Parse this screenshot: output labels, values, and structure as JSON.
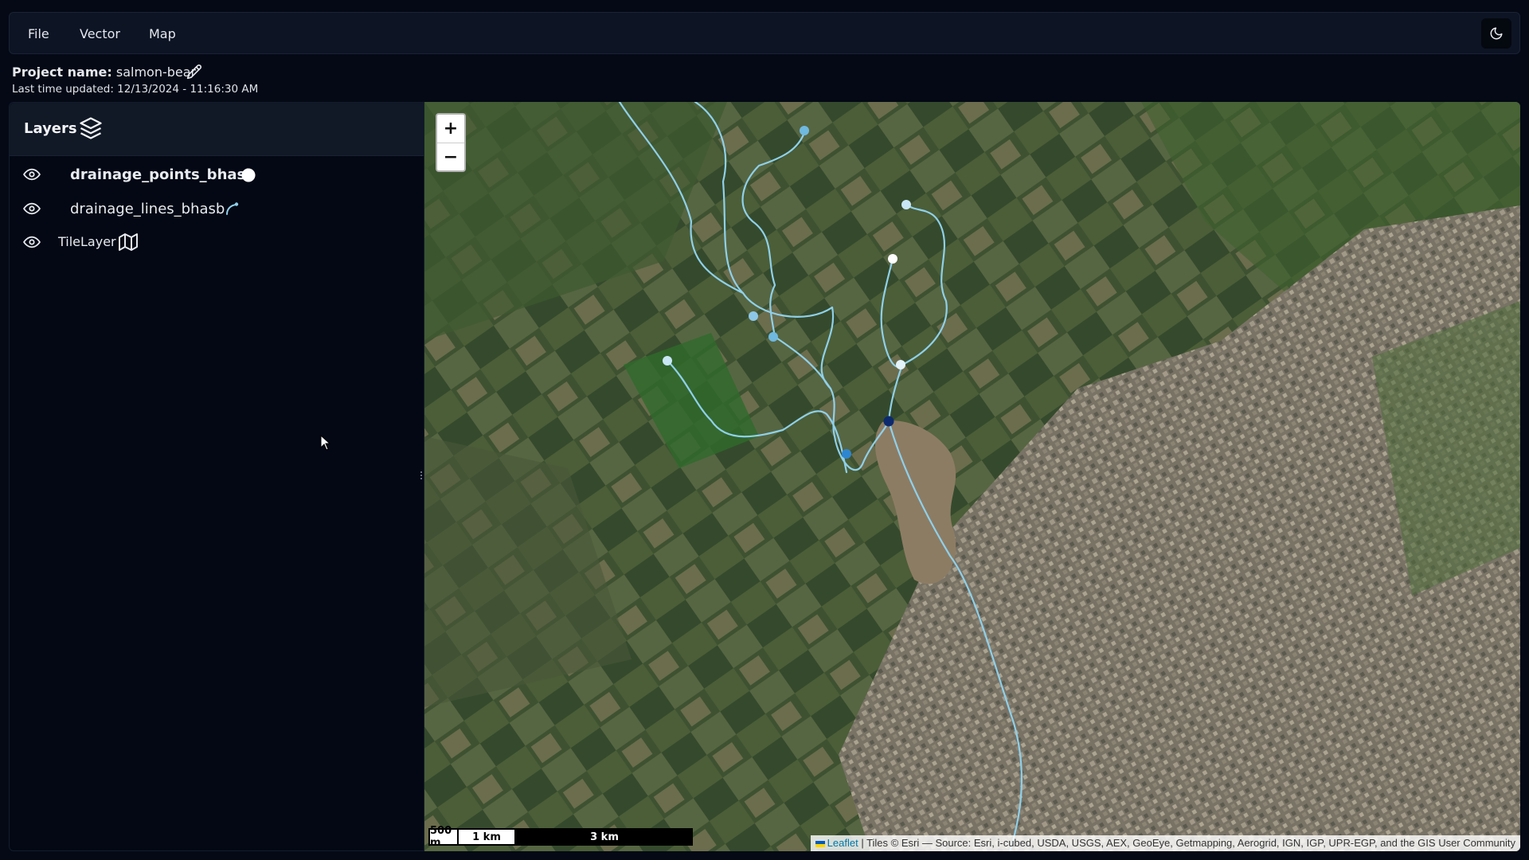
{
  "menubar": {
    "items": [
      "File",
      "Vector",
      "Map"
    ],
    "theme_icon": "moon-icon"
  },
  "project": {
    "name_label": "Project name:",
    "name_value": "salmon-bear",
    "edit_icon": "pencil-icon",
    "updated": "Last time updated: 12/13/2024 - 11:16:30 AM"
  },
  "layers_panel": {
    "title": "Layers",
    "title_icon": "layers-icon",
    "layers": [
      {
        "name": "drainage_points_bhasb",
        "icon": "circle-point-icon",
        "visible": true
      },
      {
        "name": "drainage_lines_bhasb",
        "icon": "line-path-icon",
        "visible": true
      },
      {
        "name": "TileLayer",
        "icon": "map-icon",
        "visible": true
      }
    ]
  },
  "map": {
    "zoom_in": "+",
    "zoom_out": "−",
    "scale": [
      "500 m",
      "1 km",
      "3 km"
    ],
    "attribution_link": "Leaflet",
    "attribution_text": " | Tiles © Esri — Source: Esri, i-cubed, USDA, USGS, AEX, GeoEye, Getmapping, Aerogrid, IGN, IGP, UPR-EGP, and the GIS User Community",
    "colors": {
      "river": "#8fd0ea",
      "point_light": "#c8e6f5",
      "point_mid": "#6fb8e0",
      "point_blue": "#2f86d0",
      "point_dark": "#0d2a6e",
      "point_white": "#ffffff"
    }
  }
}
